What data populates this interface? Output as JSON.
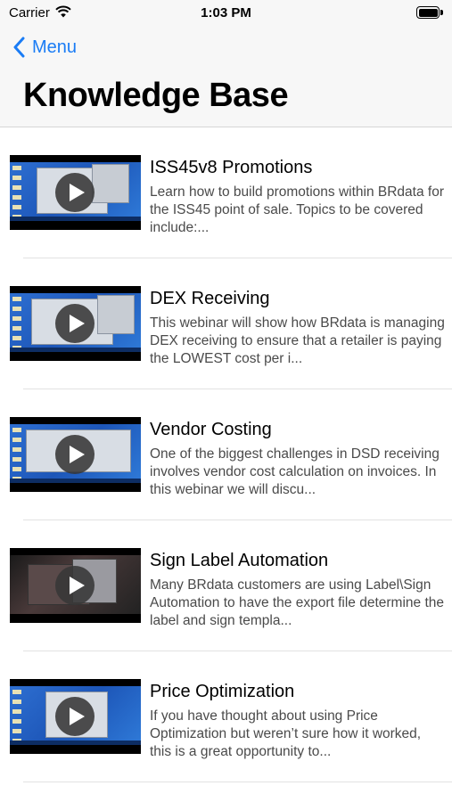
{
  "status_bar": {
    "carrier": "Carrier",
    "time": "1:03 PM",
    "wifi_icon": "wifi-icon",
    "battery_icon": "battery-icon"
  },
  "nav": {
    "back_label": "Menu",
    "back_icon": "chevron-left-icon",
    "title": "Knowledge Base",
    "accent_color": "#1a7cf5"
  },
  "videos": [
    {
      "title": "ISS45v8 Promotions",
      "description": "Learn how to build promotions within BRdata for the ISS45 point of sale. Topics to be covered include:...",
      "play_icon": "play-icon"
    },
    {
      "title": "DEX Receiving",
      "description": "This webinar will show how BRdata is managing DEX receiving to ensure that a retailer is paying the LOWEST cost per i...",
      "play_icon": "play-icon"
    },
    {
      "title": "Vendor Costing",
      "description": "One of the biggest challenges in DSD receiving involves vendor cost calculation on invoices. In this webinar we will discu...",
      "play_icon": "play-icon"
    },
    {
      "title": "Sign Label Automation",
      "description": "Many BRdata customers are using Label\\Sign Automation to have the export file determine the label and sign templa...",
      "play_icon": "play-icon"
    },
    {
      "title": "Price Optimization",
      "description": "If you have thought about using Price Optimization but weren’t sure how it worked, this is a great opportunity to...",
      "play_icon": "play-icon"
    }
  ]
}
